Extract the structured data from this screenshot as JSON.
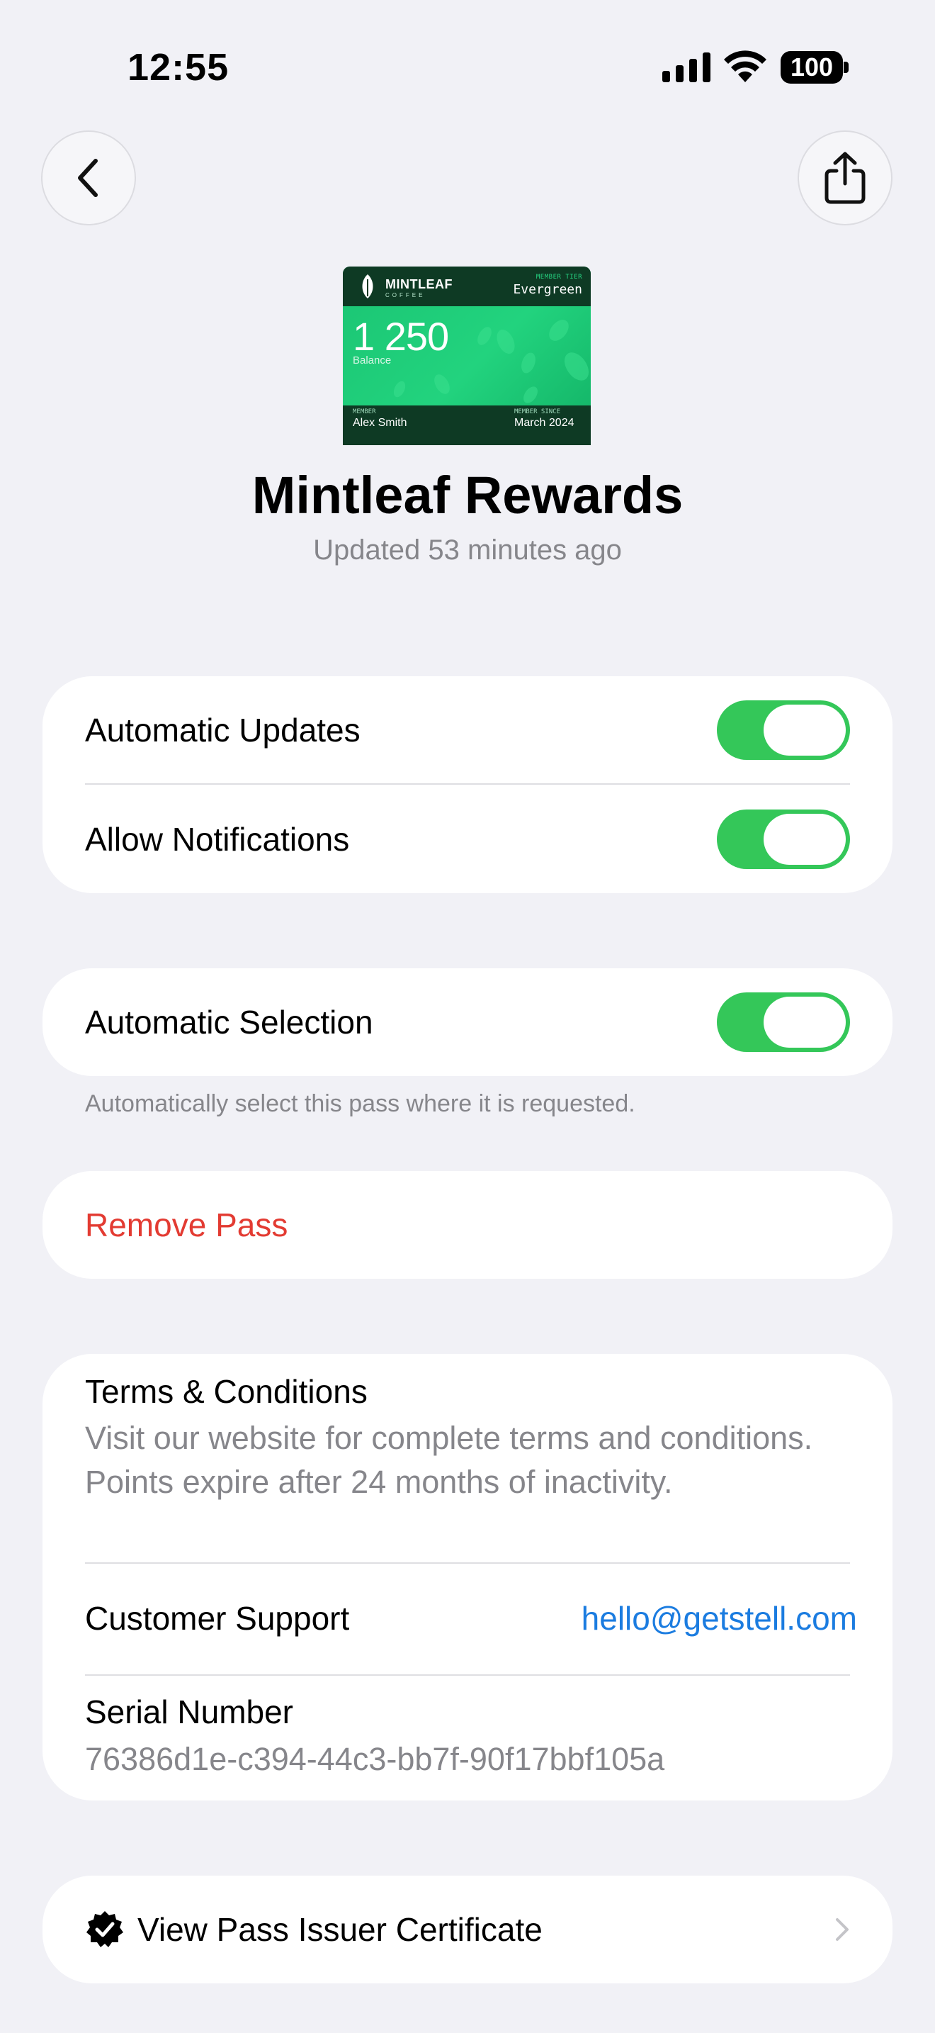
{
  "status": {
    "time": "12:55",
    "battery": "100"
  },
  "card": {
    "brand": "MINTLEAF",
    "brand_sub": "COFFEE",
    "tier_label": "MEMBER TIER",
    "tier_value": "Evergreen",
    "points": "1 250",
    "points_label": "Balance",
    "member_label": "MEMBER",
    "member_name": "Alex Smith",
    "since_label": "MEMBER SINCE",
    "since_value": "March 2024",
    "colors": {
      "header": "#0E3A24",
      "body": "#1ECB76"
    }
  },
  "header": {
    "title": "Mintleaf Rewards",
    "subtitle": "Updated 53 minutes ago"
  },
  "settings": {
    "automatic_updates": {
      "label": "Automatic Updates",
      "on": true
    },
    "allow_notifications": {
      "label": "Allow Notifications",
      "on": true
    },
    "automatic_selection": {
      "label": "Automatic Selection",
      "on": true
    },
    "selection_note": "Automatically select this pass where it is requested."
  },
  "remove": {
    "label": "Remove Pass"
  },
  "info": {
    "terms_title": "Terms & Conditions",
    "terms_body": "Visit our website for complete terms and conditions. Points expire after 24 months of inactivity.",
    "support_label": "Customer Support",
    "support_email": "hello@getstell.com",
    "serial_label": "Serial Number",
    "serial_value": "76386d1e-c394-44c3-bb7f-90f17bbf105a"
  },
  "certificate": {
    "label": "View Pass Issuer Certificate"
  },
  "colors": {
    "toggle_on": "#34C759",
    "destructive": "#E33B32",
    "link": "#1B7CE0",
    "background": "#F1F1F6"
  }
}
